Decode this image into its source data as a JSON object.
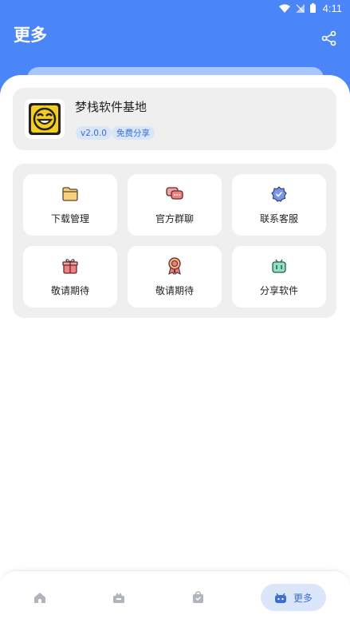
{
  "status_bar": {
    "time": "4:11"
  },
  "header": {
    "title": "更多"
  },
  "app": {
    "name": "梦栈软件基地",
    "version": "v2.0.0",
    "license": "免费分享"
  },
  "tools": [
    {
      "label": "下载管理",
      "icon": "folder-icon"
    },
    {
      "label": "官方群聊",
      "icon": "chat-icon"
    },
    {
      "label": "联系客服",
      "icon": "verified-badge-icon"
    },
    {
      "label": "敬请期待",
      "icon": "gift-icon"
    },
    {
      "label": "敬请期待",
      "icon": "medal-icon"
    },
    {
      "label": "分享软件",
      "icon": "share-box-icon"
    }
  ],
  "bottom_nav": {
    "items": [
      {
        "icon": "home-icon"
      },
      {
        "icon": "category-icon"
      },
      {
        "icon": "bag-icon"
      },
      {
        "icon": "more-icon",
        "label": "更多",
        "active": true
      }
    ]
  },
  "colors": {
    "accent": "#4a86f7",
    "card_bg": "#efefef",
    "tag_bg": "#d9e5f9"
  }
}
